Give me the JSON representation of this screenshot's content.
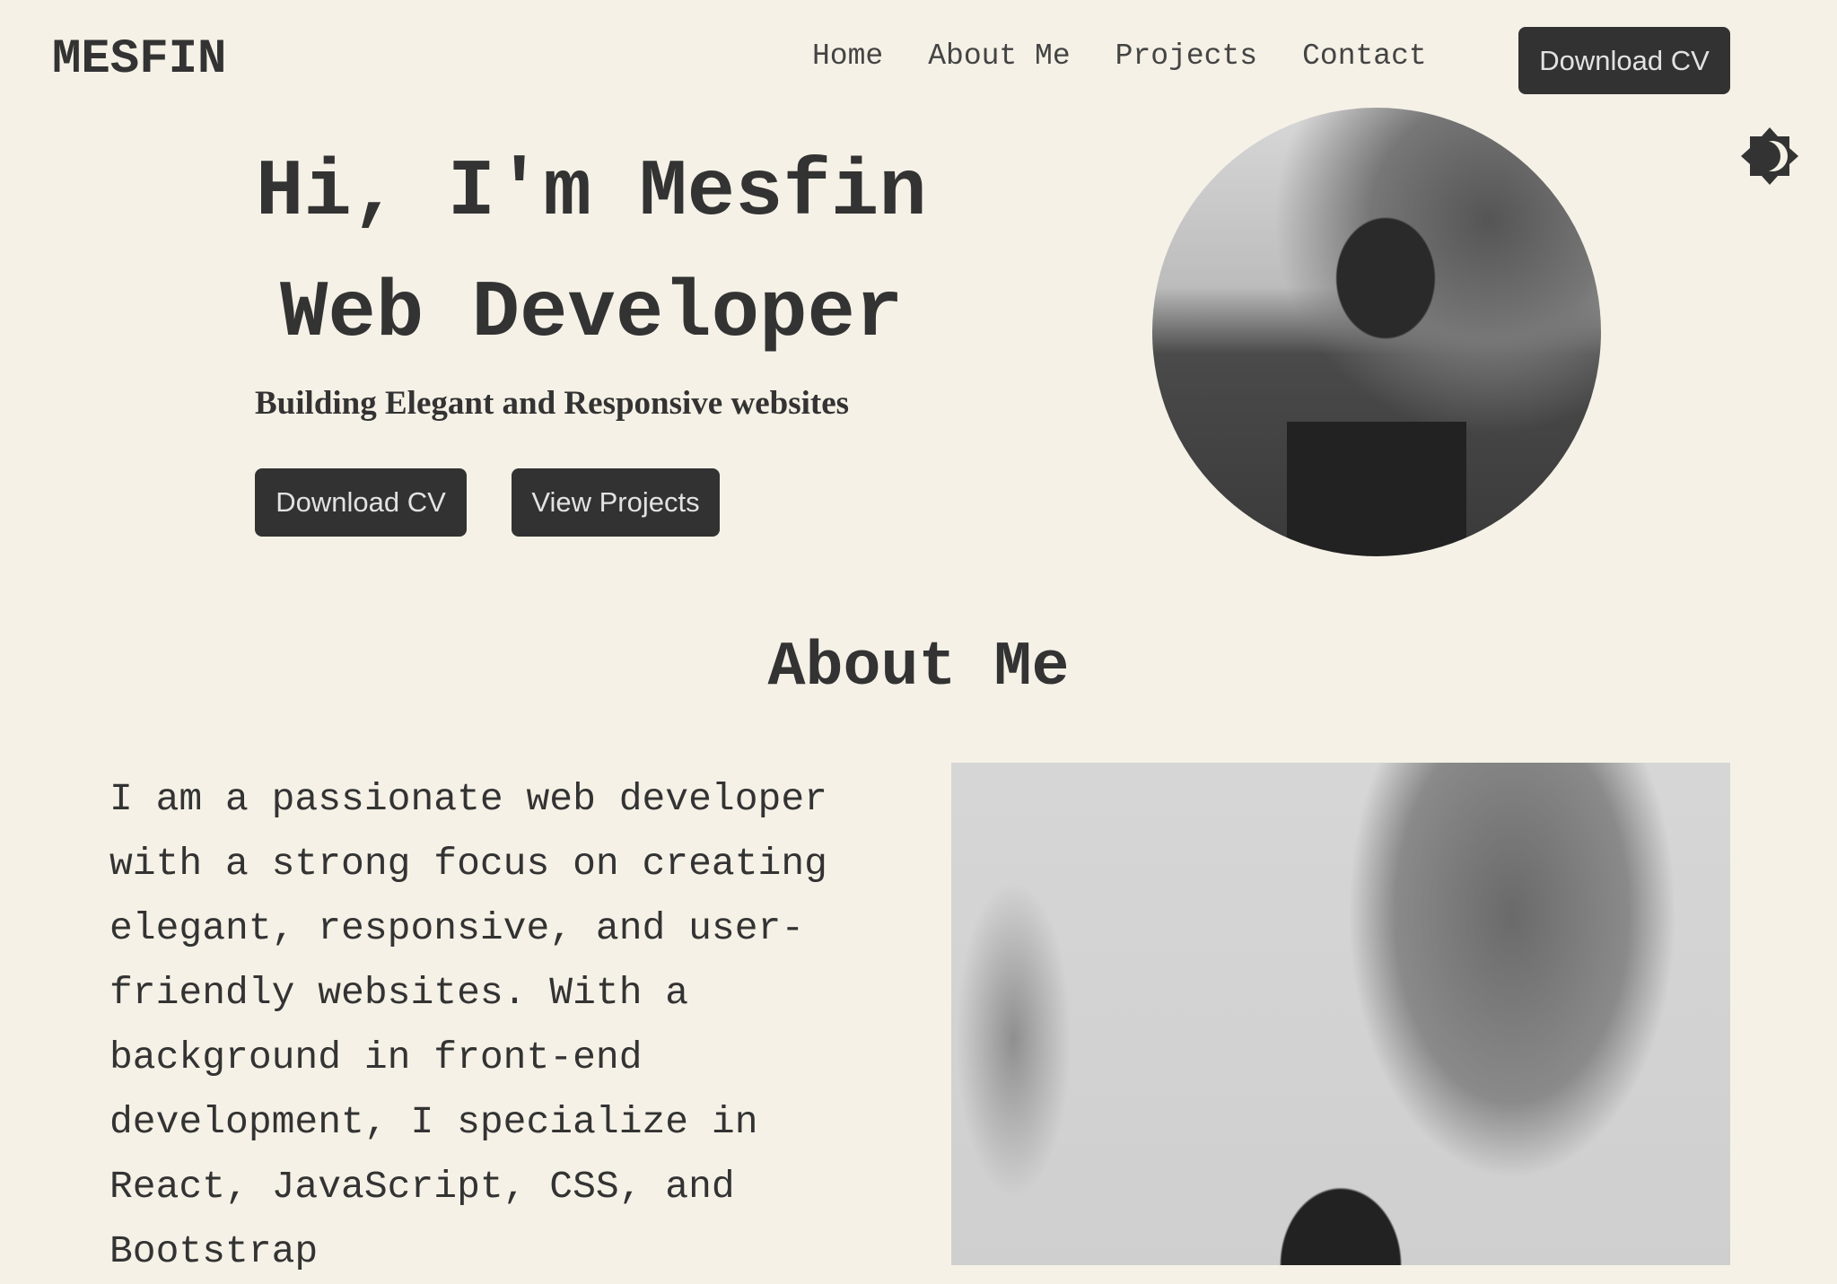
{
  "header": {
    "logo": "MESFIN",
    "nav": [
      "Home",
      "About Me",
      "Projects",
      "Contact"
    ],
    "download_cv": "Download CV",
    "theme_icon": "theme-toggle-icon"
  },
  "hero": {
    "greeting": "Hi, I'm Mesfin",
    "role": "Web Developer",
    "subtitle": "Building Elegant and Responsive websites",
    "download_cv": "Download CV",
    "view_projects": "View Projects"
  },
  "about": {
    "title": "About Me",
    "text": "I am a passionate web developer with a strong focus on creating elegant, responsive, and user-friendly websites. With a background in front-end development, I specialize in React, JavaScript, CSS, and Bootstrap"
  },
  "colors": {
    "background": "#f5f1e6",
    "text": "#333333",
    "button": "#323232"
  }
}
